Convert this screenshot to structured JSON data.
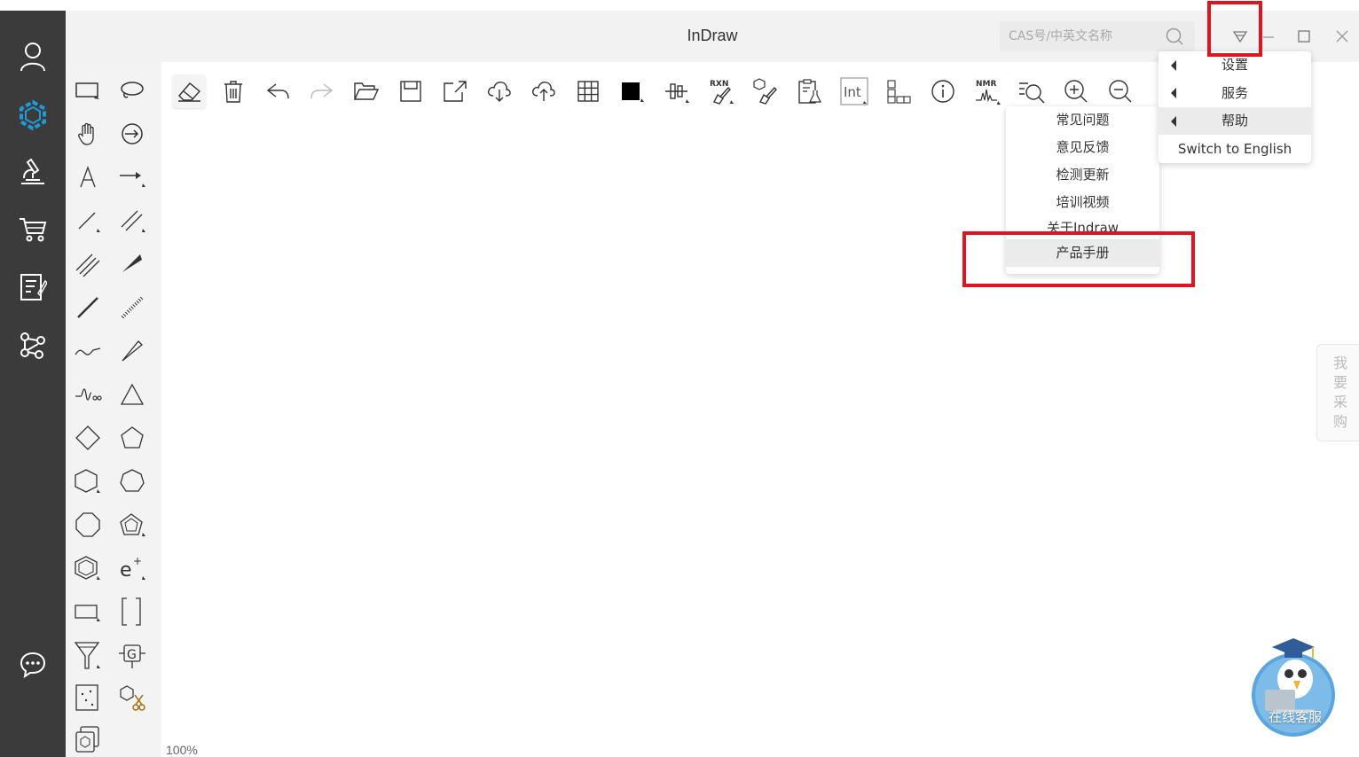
{
  "window": {
    "title": "InDraw"
  },
  "search": {
    "placeholder": "CAS号/中英文名称"
  },
  "sidebar": {
    "items": [
      {
        "name": "user-icon"
      },
      {
        "name": "structure-icon"
      },
      {
        "name": "microscope-icon"
      },
      {
        "name": "cart-icon"
      },
      {
        "name": "notes-icon"
      },
      {
        "name": "network-icon"
      },
      {
        "name": "chat-icon"
      }
    ]
  },
  "toolbar": {
    "rxn_label": "RXN",
    "int_label": "Int",
    "nmr_label": "NMR"
  },
  "main_menu": {
    "items": [
      {
        "label": "设置",
        "has_submenu": true
      },
      {
        "label": "服务",
        "has_submenu": true
      },
      {
        "label": "帮助",
        "has_submenu": true,
        "highlighted": true
      },
      {
        "label": "Switch to English",
        "has_submenu": false
      }
    ]
  },
  "help_menu": {
    "items": [
      {
        "label": "常见问题"
      },
      {
        "label": "意见反馈"
      },
      {
        "label": "检测更新"
      },
      {
        "label": "培训视频"
      },
      {
        "label": "关于Indraw"
      },
      {
        "label": "产品手册",
        "highlighted": true
      }
    ]
  },
  "status": {
    "zoom": "100%"
  },
  "side_tab": {
    "label": "我要采购"
  },
  "service": {
    "label": "在线客服"
  },
  "colors": {
    "highlight": "#e0141e",
    "sidebar": "#3b3b3b",
    "accent": "#1e9bd7"
  }
}
